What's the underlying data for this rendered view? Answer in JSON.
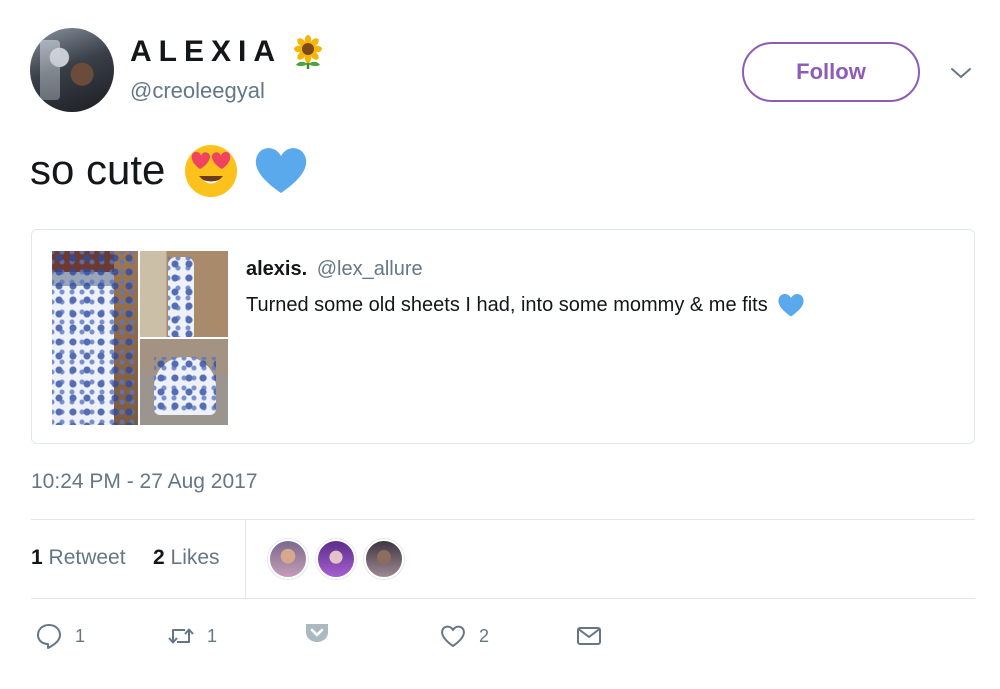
{
  "tweet": {
    "author": {
      "display_name": "ALEXIA",
      "display_name_emoji": "sunflower-emoji",
      "handle": "@creoleegyal"
    },
    "follow_label": "Follow",
    "text": "so cute",
    "text_emojis": [
      "heart-eyes-emoji",
      "blue-heart-emoji"
    ],
    "quoted": {
      "name": "alexis.",
      "handle": "@lex_allure",
      "text": "Turned some old sheets I had, into some mommy & me fits",
      "text_emoji": "blue-heart-emoji"
    },
    "timestamp": "10:24 PM - 27 Aug 2017",
    "stats": {
      "retweet_count": "1",
      "retweet_label": "Retweet",
      "like_count": "2",
      "like_label": "Likes"
    },
    "actions": {
      "reply_count": "1",
      "retweet_count": "1",
      "like_count": "2"
    }
  },
  "colors": {
    "accent": "#8e5bb7",
    "text_primary": "#14171a",
    "text_secondary": "#657786",
    "border": "#e1e8ed",
    "blue_heart": "#5aa9ec"
  }
}
